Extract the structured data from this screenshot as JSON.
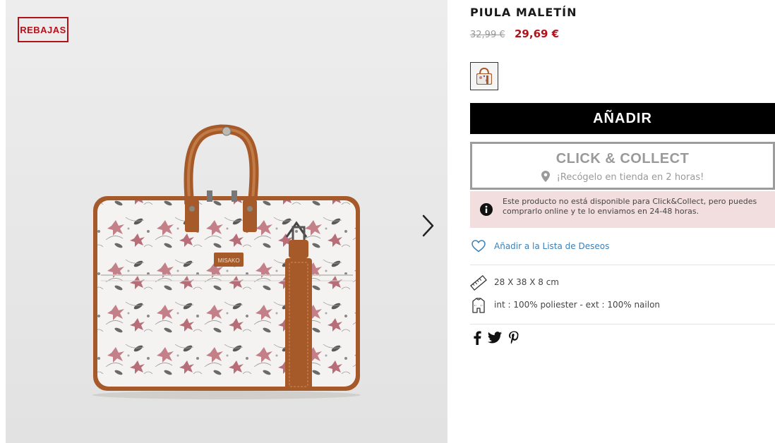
{
  "gallery": {
    "badge": "REBAJAS",
    "bag_logo": "MISAKO",
    "next_icon": "chevron-right-icon"
  },
  "product": {
    "title": "PIULA MALETÍN",
    "old_price": "32,99 €",
    "new_price": "29,69 €"
  },
  "actions": {
    "add_label": "AÑADIR",
    "click_collect": {
      "title": "CLICK & COLLECT",
      "subtitle": "¡Recógelo en tienda en 2 horas!"
    },
    "notice": "Este producto no está disponible para Click&Collect, pero puedes comprarlo online y te lo enviamos en 24-48 horas.",
    "wishlist_label": "Añadir a la Lista de Deseos"
  },
  "specs": {
    "dimensions": "28 X 38 X 8 cm",
    "material": "int : 100% poliester - ext : 100% nailon"
  },
  "social": [
    "facebook-icon",
    "twitter-icon",
    "pinterest-icon"
  ],
  "colors": {
    "sale_red": "#b3121b",
    "link_blue": "#3a80b8",
    "notice_bg": "#f3dedf",
    "leather_brown": "#a65a2a"
  }
}
